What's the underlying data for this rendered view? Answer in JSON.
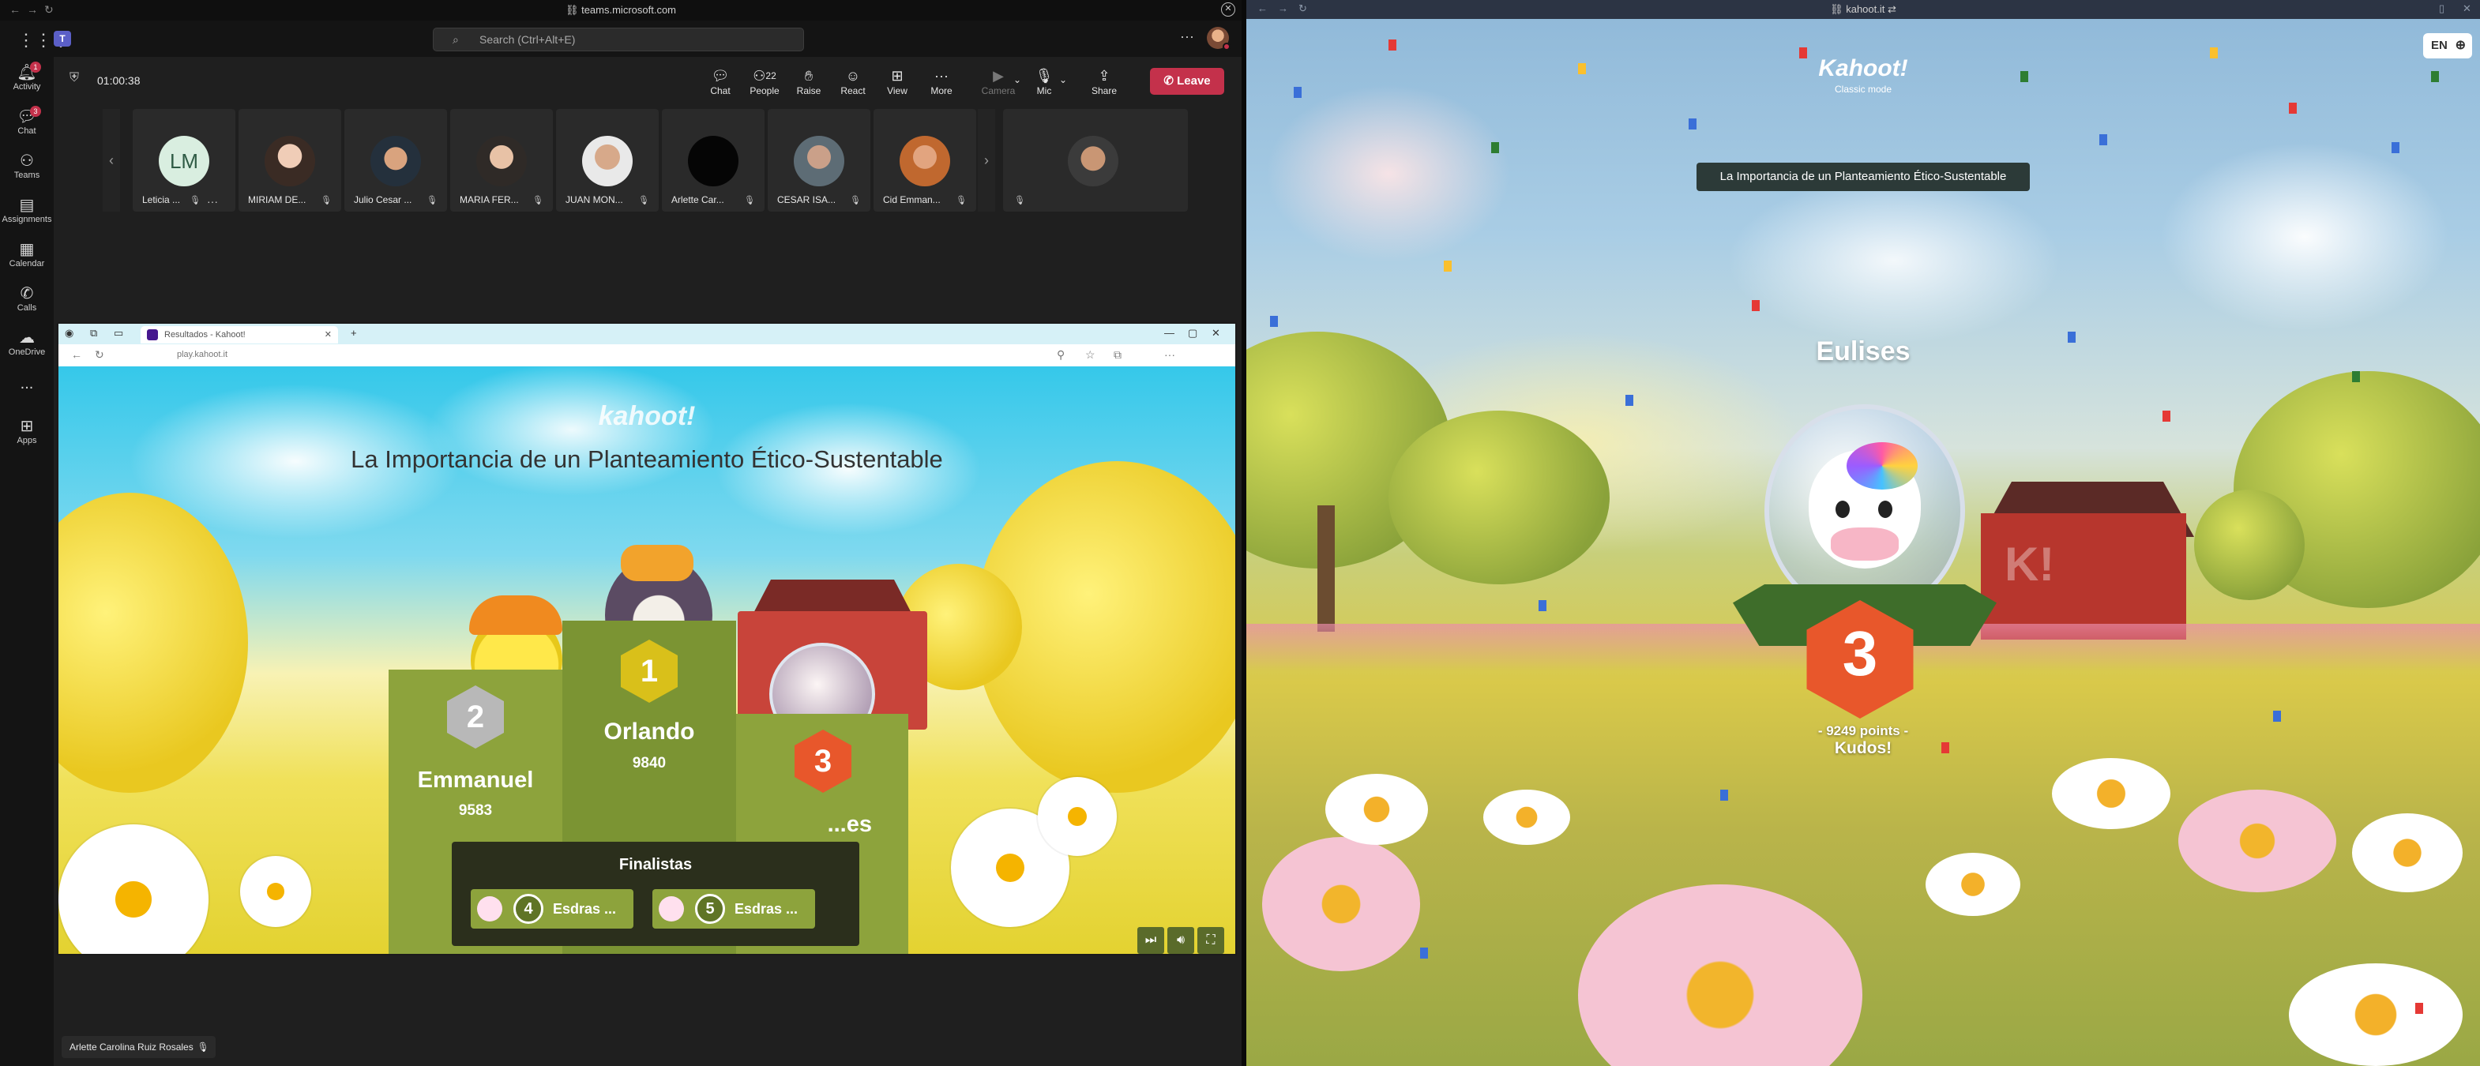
{
  "teams_window": {
    "url": "teams.microsoft.com",
    "search_placeholder": "Search (Ctrl+Alt+E)",
    "rail": [
      {
        "label": "Activity",
        "icon": "bell-icon",
        "badge": "1"
      },
      {
        "label": "Chat",
        "icon": "chat-icon",
        "badge": "3"
      },
      {
        "label": "Teams",
        "icon": "teams-icon",
        "badge": ""
      },
      {
        "label": "Assignments",
        "icon": "assignments-icon",
        "badge": ""
      },
      {
        "label": "Calendar",
        "icon": "calendar-icon",
        "badge": ""
      },
      {
        "label": "Calls",
        "icon": "phone-icon",
        "badge": ""
      },
      {
        "label": "OneDrive",
        "icon": "cloud-icon",
        "badge": ""
      },
      {
        "label": "...",
        "icon": "more-icon",
        "badge": ""
      },
      {
        "label": "Apps",
        "icon": "apps-icon",
        "badge": ""
      }
    ],
    "meeting": {
      "timer": "01:00:38",
      "controls": {
        "chat": "Chat",
        "people": "People",
        "people_count": "22",
        "raise": "Raise",
        "react": "React",
        "view": "View",
        "more": "More",
        "camera": "Camera",
        "mic": "Mic",
        "share": "Share",
        "leave": "Leave"
      }
    },
    "participants": [
      {
        "name": "Leticia ...",
        "initials": "LM"
      },
      {
        "name": "MIRIAM DE...",
        "initials": ""
      },
      {
        "name": "Julio Cesar ...",
        "initials": ""
      },
      {
        "name": "MARIA FER...",
        "initials": ""
      },
      {
        "name": "JUAN MON...",
        "initials": ""
      },
      {
        "name": "Arlette Car...",
        "initials": ""
      },
      {
        "name": "CESAR ISA...",
        "initials": ""
      },
      {
        "name": "Cid Emman...",
        "initials": ""
      }
    ],
    "self_name": "Arlette Carolina Ruiz Rosales"
  },
  "shared_screen": {
    "tab_title": "Resultados - Kahoot!",
    "address": "play.kahoot.it",
    "logo": "kahoot!",
    "quiz_title": "La Importancia de un Planteamiento Ético-Sustentable",
    "podium": [
      {
        "rank": "1",
        "name": "Orlando",
        "score": "9840"
      },
      {
        "rank": "2",
        "name": "Emmanuel",
        "score": "9583"
      },
      {
        "rank": "3",
        "name": "...es",
        "score": ""
      }
    ],
    "finalists_title": "Finalistas",
    "finalists": [
      {
        "pos": "4",
        "name": "Esdras ..."
      },
      {
        "pos": "5",
        "name": "Esdras ..."
      }
    ]
  },
  "kahoot_window": {
    "url": "kahoot.it",
    "logo": "Kahoot!",
    "mode": "Classic mode",
    "lang": "EN",
    "quiz_title": "La Importancia de un Planteamiento Ético-Sustentable",
    "player_name": "Eulises",
    "rank": "3",
    "points": "- 9249 points -",
    "message": "Kudos!"
  },
  "colors": {
    "teams_bg": "#1f1f1f",
    "leave_red": "#c4314b",
    "podium_green": "#8da33c",
    "medal_orange": "#e8572b",
    "medal_gold": "#d9c01a",
    "medal_silver": "#b8b8b8"
  }
}
